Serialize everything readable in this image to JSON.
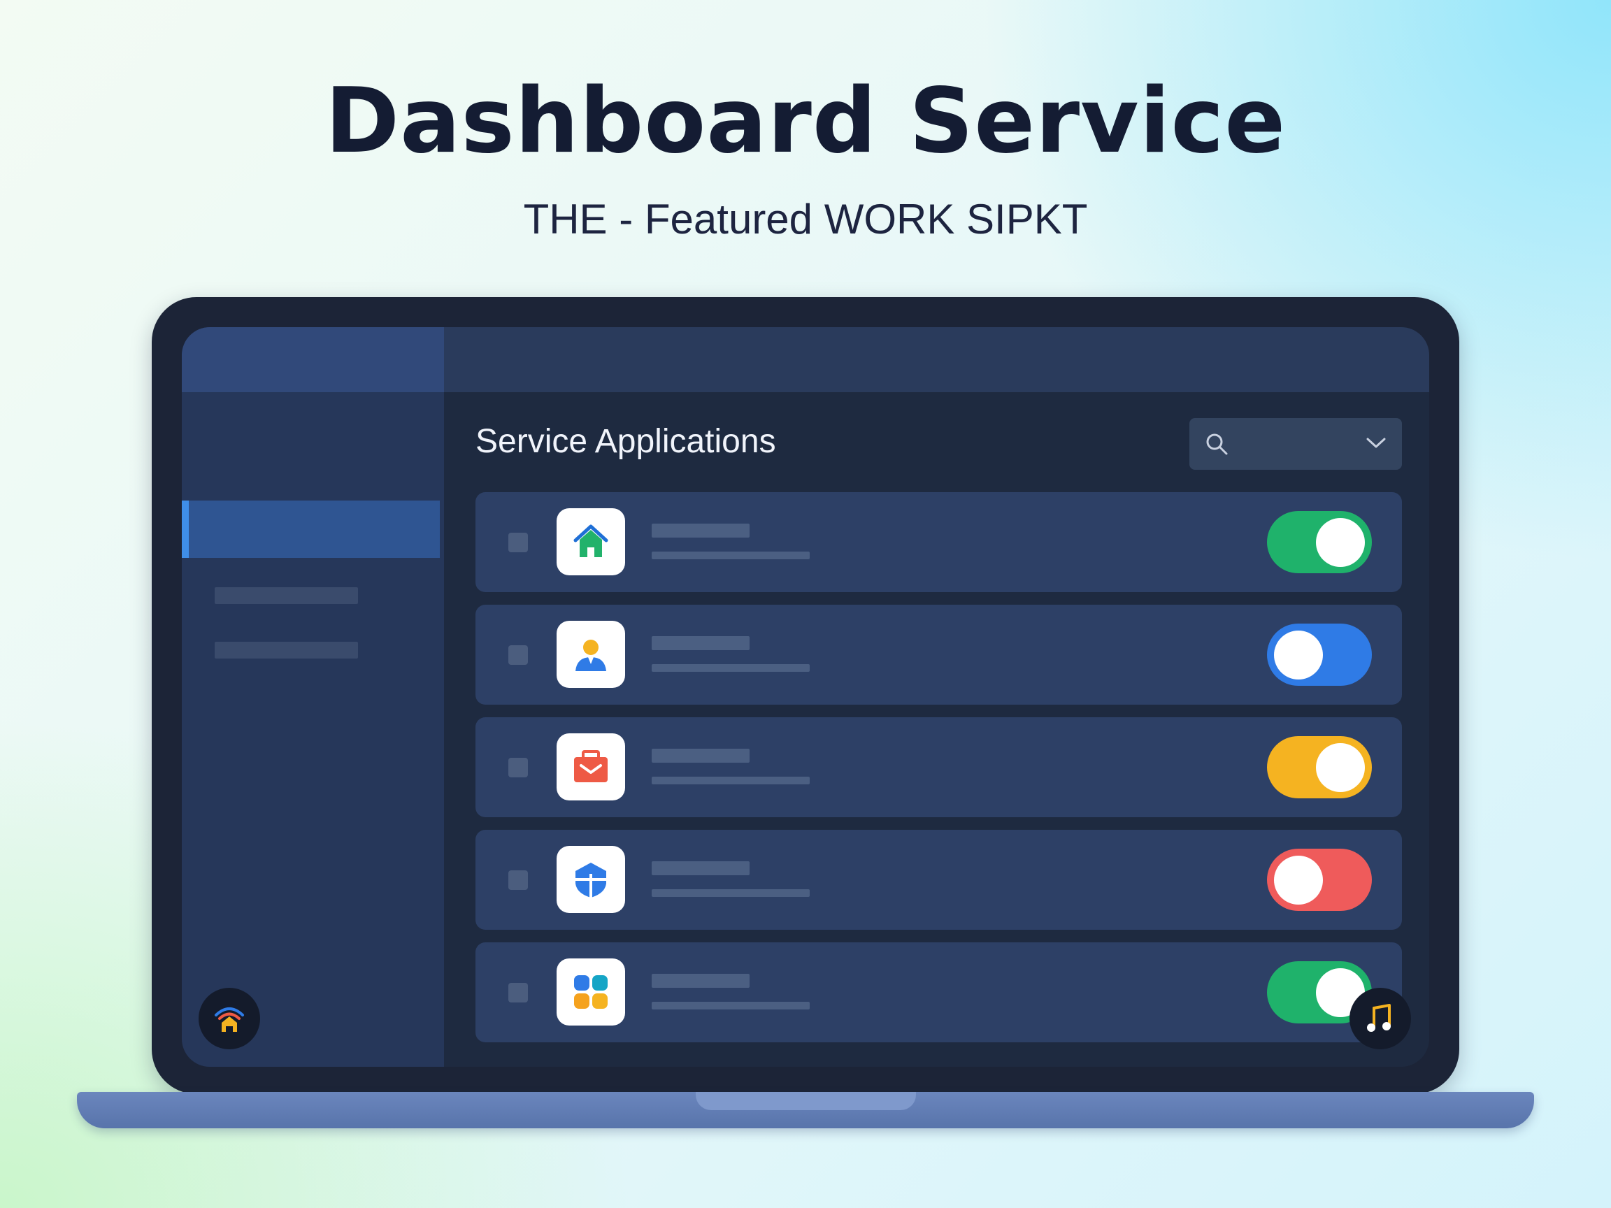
{
  "hero": {
    "title": "Dashboard Service",
    "subtitle": "THE - Featured WORK SIPKT"
  },
  "main": {
    "title": "Service Applications",
    "search": {
      "icon": "search-icon",
      "dropdown_icon": "chevron-down-icon"
    }
  },
  "services": [
    {
      "icon": "home-icon",
      "icon_color": "#22b26b",
      "toggle_state": "on",
      "toggle_color": "#1fb26b"
    },
    {
      "icon": "user-icon",
      "icon_color": "#2f7be6",
      "toggle_state": "off",
      "toggle_color": "#2f7be6"
    },
    {
      "icon": "mail-icon",
      "icon_color": "#ee5a45",
      "toggle_state": "on",
      "toggle_color": "#f5b321"
    },
    {
      "icon": "shield-icon",
      "icon_color": "#2f7be6",
      "toggle_state": "off",
      "toggle_color": "#ef5b5b"
    },
    {
      "icon": "apps-grid-icon",
      "icon_color": "#2f7be6",
      "toggle_state": "on",
      "toggle_color": "#1fb26b"
    }
  ],
  "colors": {
    "screen_bg": "#1e2a40",
    "sidebar_bg": "#26375a",
    "row_bg": "#2d4066",
    "sidebar_active": "#2f5592"
  },
  "floating_buttons": {
    "left_icon": "wifi-home-icon",
    "right_icon": "music-note-icon"
  }
}
